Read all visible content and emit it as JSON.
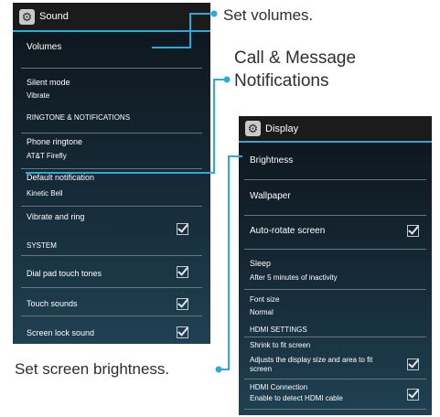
{
  "sound_screen": {
    "title": "Sound",
    "items": {
      "volumes": "Volumes",
      "silent_mode": "Silent mode",
      "silent_mode_value": "Vibrate",
      "ringtone_header": "RINGTONE & NOTIFICATIONS",
      "phone_ringtone": "Phone ringtone",
      "phone_ringtone_value": "AT&T Firefly",
      "default_notification": "Default notification",
      "default_notification_value": "Kinetic Bell",
      "vibrate_and_ring": "Vibrate and ring",
      "system_header": "SYSTEM",
      "dial_pad_tones": "Dial pad touch tones",
      "touch_sounds": "Touch sounds",
      "screen_lock_sound": "Screen lock sound"
    },
    "checked": {
      "vibrate_and_ring": true,
      "dial_pad_tones": true,
      "touch_sounds": true,
      "screen_lock_sound": true
    }
  },
  "display_screen": {
    "title": "Display",
    "items": {
      "brightness": "Brightness",
      "wallpaper": "Wallpaper",
      "auto_rotate": "Auto-rotate screen",
      "sleep": "Sleep",
      "sleep_value": "After 5 minutes of inactivity",
      "font_size": "Font size",
      "font_size_value": "Normal",
      "hdmi_header": "HDMI SETTINGS",
      "shrink": "Shrink to fit screen",
      "shrink_desc_line1": "Adjusts the display size and area to fit",
      "shrink_desc_line2": "screen",
      "hdmi_connection": "HDMI Connection",
      "hdmi_connection_desc": "Enable to detect HDMI cable"
    },
    "checked": {
      "auto_rotate": true,
      "shrink": true,
      "hdmi_connection": true
    }
  },
  "callouts": {
    "set_volumes": "Set volumes.",
    "call_message_line1": "Call & Message",
    "call_message_line2": "Notifications",
    "set_brightness": "Set screen brightness."
  },
  "colors": {
    "accent": "#2fa9d9",
    "screen_top": "#0d141a",
    "screen_bottom": "#1f4152",
    "callout_text": "#2e2e2e"
  }
}
